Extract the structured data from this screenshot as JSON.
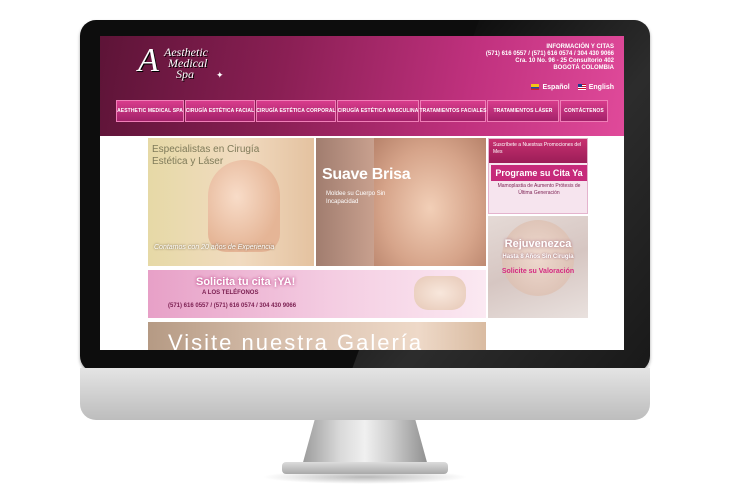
{
  "site": {
    "logo": {
      "letter": "A",
      "line1": "Aesthetic",
      "line2": "Medical",
      "line3": "Spa",
      "star": "✦"
    },
    "contact": {
      "title": "INFORMACIÓN Y CITAS",
      "phones": "(571) 616 0557 / (571) 616 0574 / 304 430 9066",
      "address": "Cra. 10 No. 96 - 25 Consultorio 402",
      "city": "BOGOTÁ COLOMBIA"
    },
    "languages": [
      "Español",
      "English"
    ],
    "nav": [
      "Aesthetic Medical Spa",
      "Cirugía Estética Facial",
      "Cirugía Estética Corporal",
      "Cirugía Estética Masculina",
      "Tratamientos Faciales",
      "Tratamientos Láser",
      "Contáctenos"
    ],
    "banners": {
      "left_title": "Especialistas en Cirugía Estética y Láser",
      "left_caption": "Contamos con 20 años de Experiencia",
      "mid_title": "Suave Brisa",
      "mid_sub": "Moldee su Cuerpo Sin Incapacidad",
      "book_title": "Solicita tu cita ¡YA!",
      "book_sub": "A LOS TELÉFONOS",
      "book_phones": "(571) 616 0557 / (571) 616 0574 / 304 430 9066",
      "gallery_text": "Visite nuestra Galería"
    },
    "promo": {
      "header": "Suscríbete a Nuestras Promociones del Mes",
      "title": "Programe su Cita Ya",
      "text": "Mamoplastia de Aumento Prótesis de Última Generación"
    },
    "rejuv": {
      "title": "Rejuvenezca",
      "sub": "Hasta 8 Años Sin Cirugía",
      "cta": "Solicite su Valoración"
    }
  },
  "colors": {
    "brand_dark": "#5d1437",
    "brand_pink": "#d83c8c",
    "accent": "#c62a7a"
  }
}
